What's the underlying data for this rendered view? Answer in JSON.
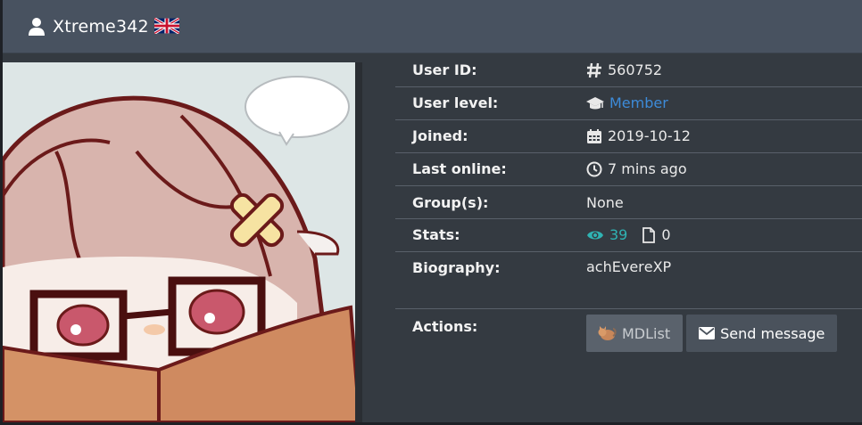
{
  "header": {
    "username": "Xtreme342",
    "flag_icon": "uk-flag-icon",
    "user_icon": "user-icon"
  },
  "info": {
    "user_id": {
      "label": "User ID:",
      "value": "560752",
      "icon": "hash-icon"
    },
    "user_level": {
      "label": "User level:",
      "value": "Member",
      "icon": "graduation-cap-icon"
    },
    "joined": {
      "label": "Joined:",
      "value": "2019-10-12",
      "icon": "calendar-icon"
    },
    "last_online": {
      "label": "Last online:",
      "value": "7 mins ago",
      "icon": "clock-icon"
    },
    "groups": {
      "label": "Group(s):",
      "value": "None"
    },
    "stats": {
      "label": "Stats:",
      "views": "39",
      "uploads": "0",
      "views_icon": "eye-icon",
      "uploads_icon": "file-icon"
    },
    "biography": {
      "label": "Biography:",
      "lines": [
        "achEver",
        "eXP"
      ]
    },
    "actions": {
      "label": "Actions:",
      "mdlist_label": "MDList",
      "send_message_label": "Send message"
    }
  },
  "colors": {
    "header_bg": "#485260",
    "panel_bg": "#343a41",
    "link": "#3d8bd9",
    "teal": "#2fb3b3",
    "button_bg": "#4a525c"
  }
}
